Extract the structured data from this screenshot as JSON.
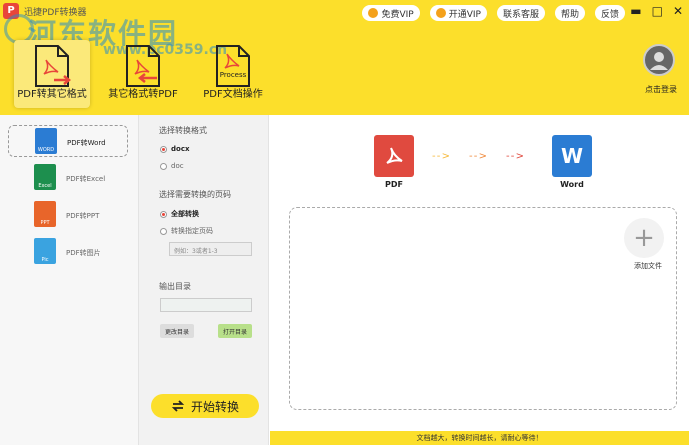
{
  "app": {
    "title": "迅捷PDF转换器",
    "logo_letter": "P"
  },
  "watermark": {
    "text": "河东软件园",
    "url": "www.pc0359.cn"
  },
  "top_buttons": [
    {
      "label": "免费VIP",
      "icon": "coin-icon"
    },
    {
      "label": "开通VIP",
      "icon": "coin-icon"
    },
    {
      "label": "联系客服"
    },
    {
      "label": "帮助"
    },
    {
      "label": "反馈"
    }
  ],
  "window_controls": {
    "minimize": "▬",
    "maximize": "□",
    "close": "✕"
  },
  "nav": [
    {
      "label": "PDF转其它格式",
      "active": true
    },
    {
      "label": "其它格式转PDF",
      "active": false
    },
    {
      "label": "PDF文档操作",
      "active": false,
      "icon_text": "Process"
    }
  ],
  "account": {
    "label": "点击登录"
  },
  "sidebar": {
    "items": [
      {
        "label": "PDF转Word",
        "badge": "WORD",
        "color": "#2b7cd3",
        "active": true
      },
      {
        "label": "PDF转Excel",
        "badge": "Excel",
        "color": "#1d8f4e",
        "active": false
      },
      {
        "label": "PDF转PPT",
        "badge": "PPT",
        "color": "#e8652a",
        "active": false
      },
      {
        "label": "PDF转图片",
        "badge": "Pic",
        "color": "#3aa3e0",
        "active": false
      }
    ]
  },
  "options": {
    "format_title": "选择转换格式",
    "formats": [
      {
        "label": "docx",
        "selected": true
      },
      {
        "label": "doc",
        "selected": false
      }
    ],
    "pages_title": "选择需要转换的页码",
    "pages": [
      {
        "label": "全部转换",
        "selected": true
      },
      {
        "label": "转换指定页码",
        "selected": false
      }
    ],
    "range_placeholder": "例如：3或者1-3",
    "output_title": "输出目录",
    "output_value": "",
    "change_dir_label": "更改目录",
    "open_dir_label": "打开目录",
    "start_label": "开始转换"
  },
  "conversion": {
    "from_label": "PDF",
    "to_label": "Word",
    "to_letter": "W",
    "colors": {
      "pdf": "#e04a3f",
      "word": "#2b7cd3",
      "arrow1": "#f6b93b",
      "arrow2": "#f08a3c",
      "arrow3": "#e04a3f"
    }
  },
  "dropzone": {
    "add_label": "添加文件",
    "add_icon": "+"
  },
  "footer": {
    "text": "文档越大，转换时间越长，请耐心等待！"
  },
  "colors": {
    "brand_yellow": "#fcdf2b",
    "accent_red": "#e8463a"
  }
}
